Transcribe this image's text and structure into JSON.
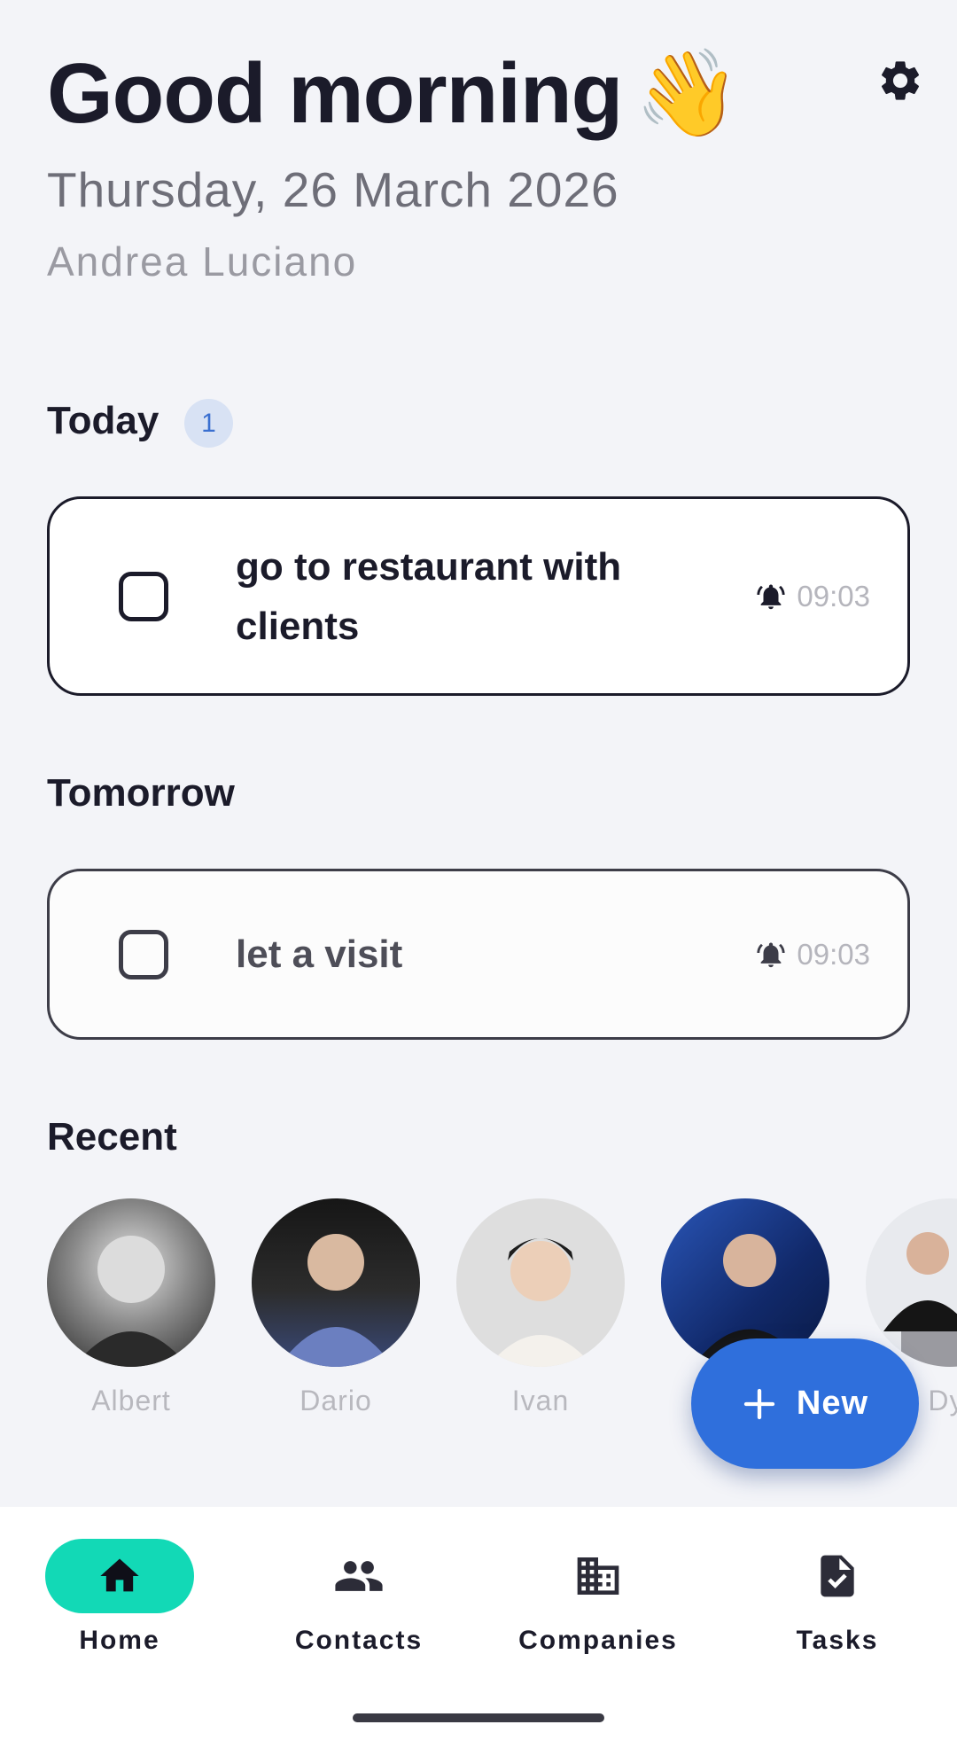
{
  "header": {
    "greeting": "Good morning",
    "greeting_emoji": "👋",
    "date": "Thursday, 26 March 2026",
    "user_name": "Andrea Luciano",
    "settings_icon": "gear-icon"
  },
  "today": {
    "title": "Today",
    "count": "1",
    "tasks": [
      {
        "text": "go to restaurant with clients",
        "time": "09:03",
        "reminder_icon": "alarm-bell-icon",
        "done": false
      }
    ]
  },
  "tomorrow": {
    "title": "Tomorrow",
    "tasks": [
      {
        "text": "let a visit",
        "time": "09:03",
        "reminder_icon": "alarm-bell-icon",
        "done": false
      }
    ]
  },
  "recent": {
    "title": "Recent",
    "contacts": [
      {
        "name": "Albert",
        "avatar_bg": "#5a5a5a"
      },
      {
        "name": "Dario",
        "avatar_bg": "#4a5a8a"
      },
      {
        "name": "Ivan",
        "avatar_bg": "#dcdcdc"
      },
      {
        "name": "",
        "avatar_bg": "#1e3a7a"
      },
      {
        "name": "Dyl",
        "avatar_bg": "#2a9a6a"
      }
    ]
  },
  "fab": {
    "label": "New",
    "icon": "plus-icon"
  },
  "nav": {
    "items": [
      {
        "label": "Home",
        "icon": "home-icon",
        "active": true
      },
      {
        "label": "Contacts",
        "icon": "people-icon",
        "active": false
      },
      {
        "label": "Companies",
        "icon": "building-icon",
        "active": false
      },
      {
        "label": "Tasks",
        "icon": "task-doc-icon",
        "active": false
      }
    ]
  },
  "colors": {
    "background": "#f3f4f8",
    "accent_fab": "#2f6fdc",
    "nav_active": "#12d9b6",
    "badge_bg": "#d8e2f4",
    "badge_text": "#3a6fd0",
    "text_primary": "#1b1b2a"
  }
}
